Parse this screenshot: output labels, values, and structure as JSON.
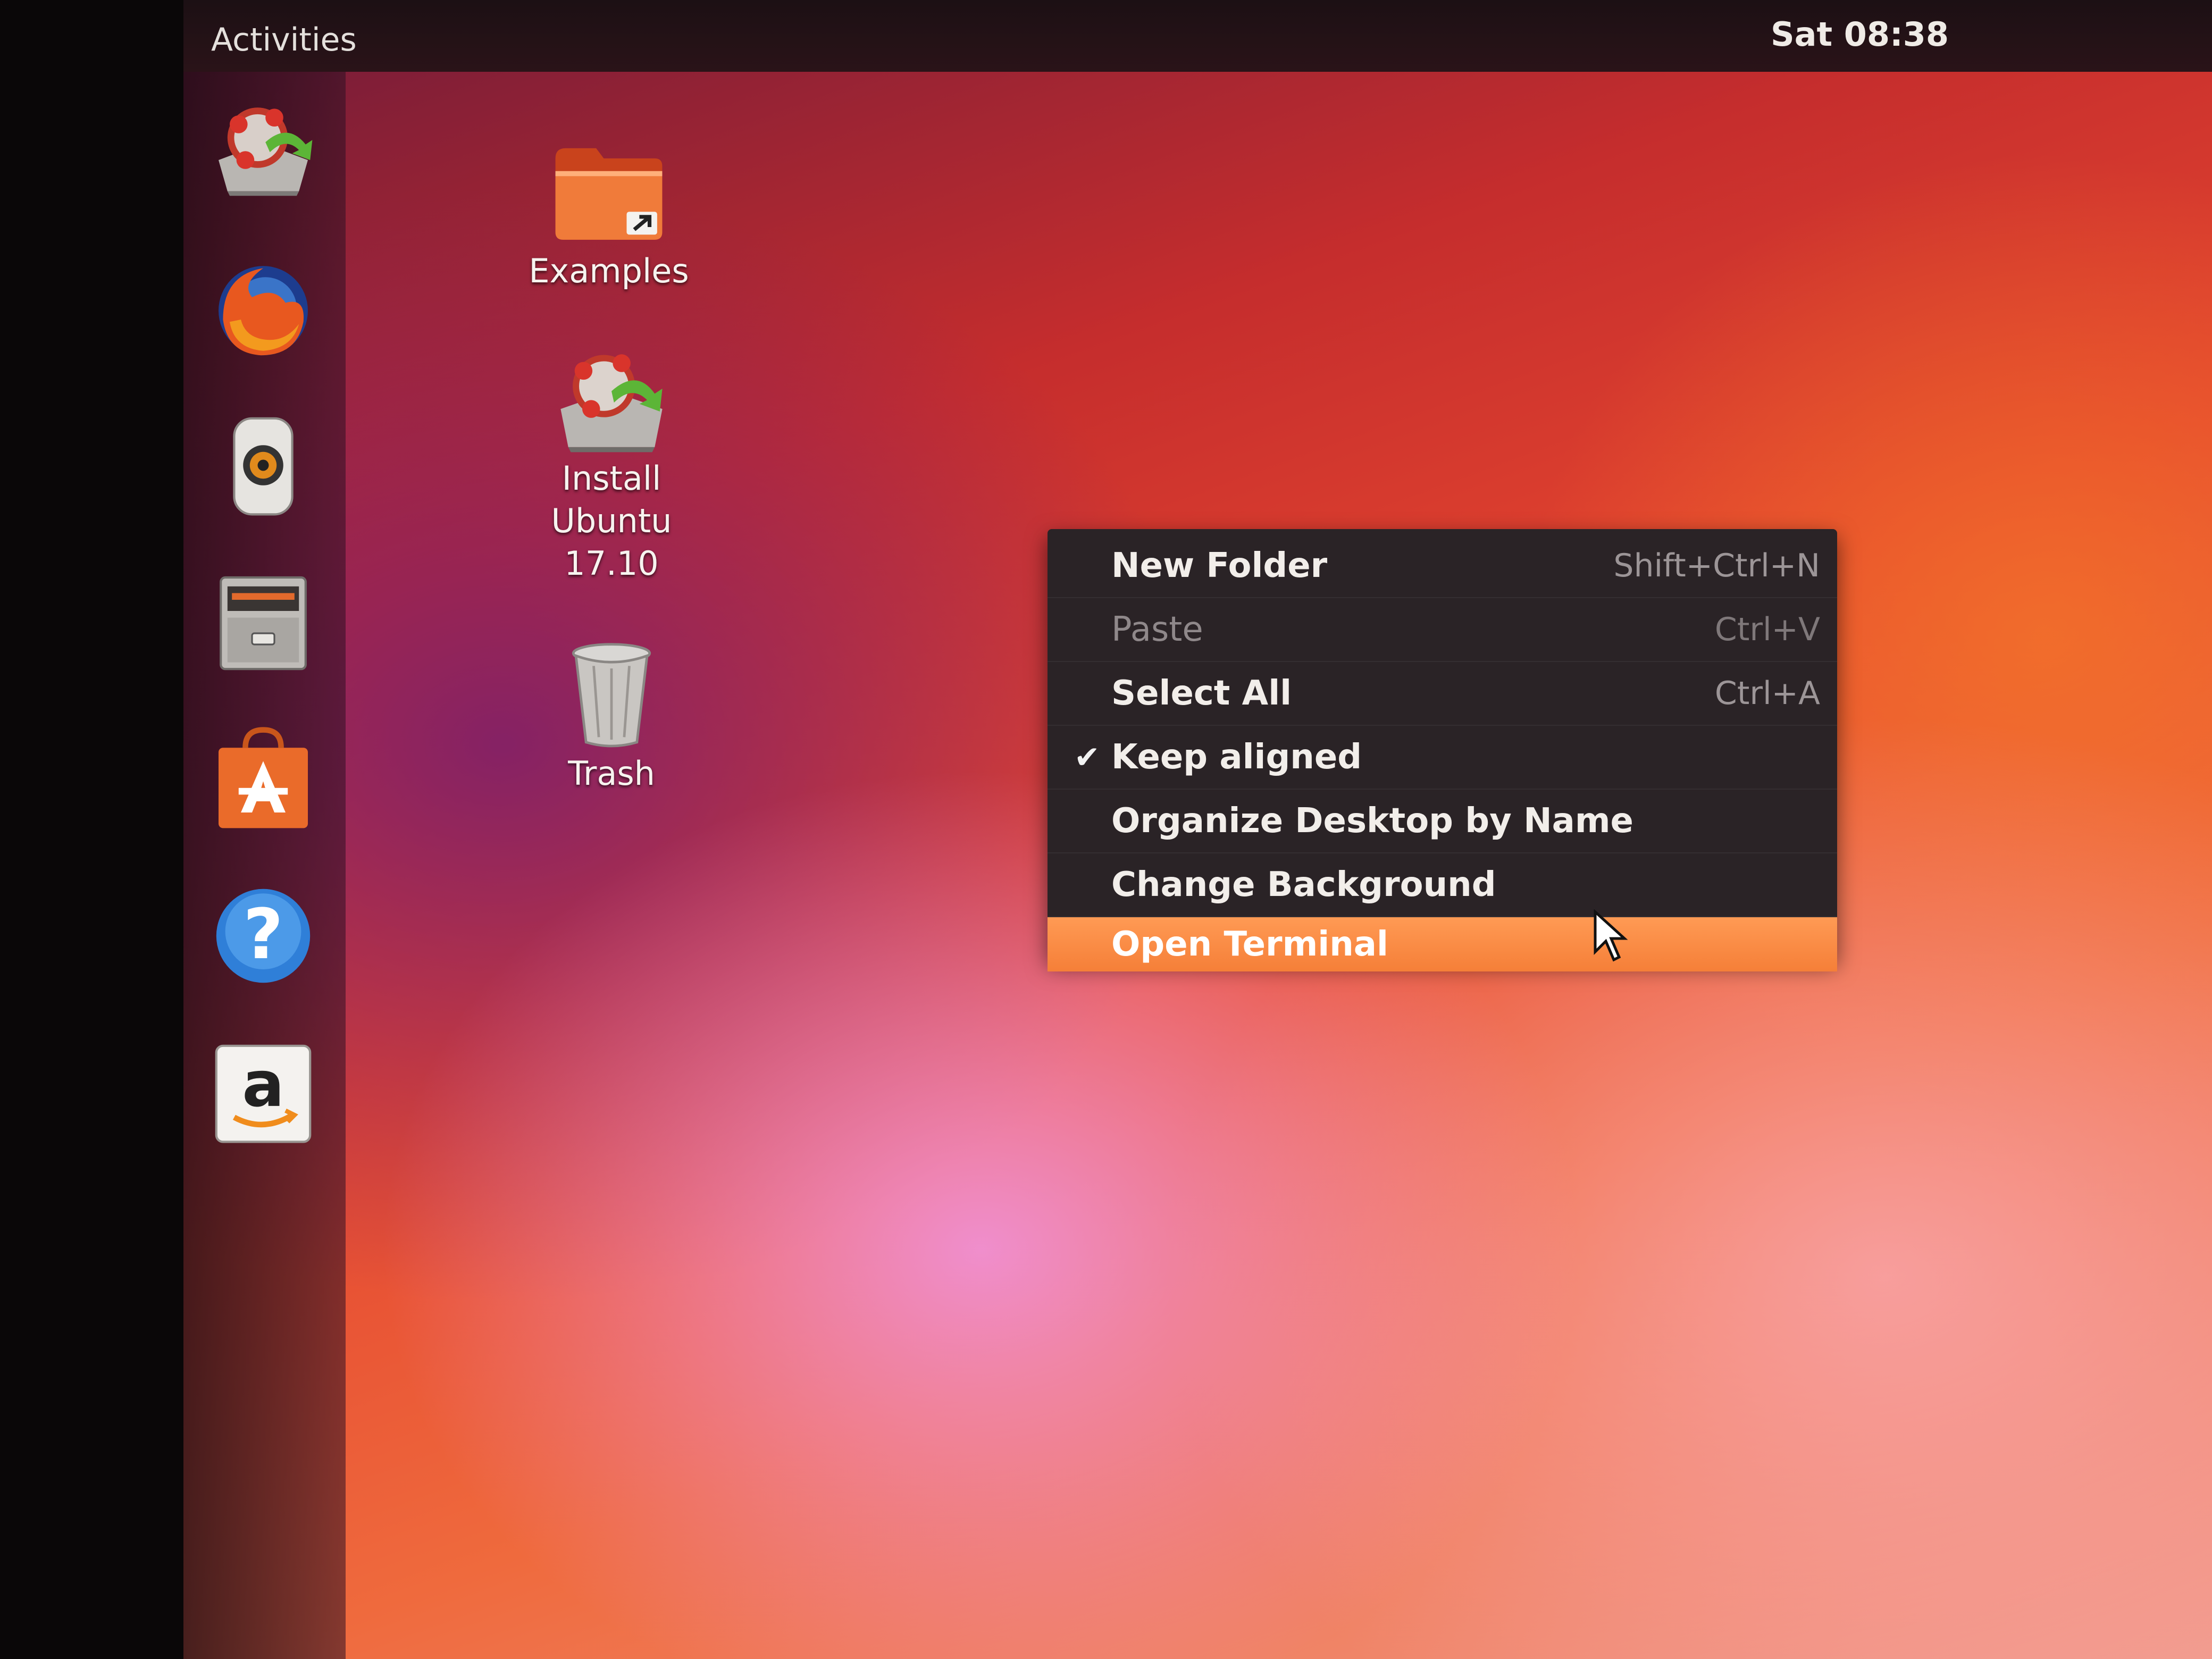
{
  "topbar": {
    "activities_label": "Activities",
    "clock": "Sat 08:38"
  },
  "dock": {
    "items": [
      {
        "icon": "install-ubuntu-icon"
      },
      {
        "icon": "firefox-icon"
      },
      {
        "icon": "rhythmbox-icon"
      },
      {
        "icon": "files-icon"
      },
      {
        "icon": "software-icon"
      },
      {
        "icon": "help-icon"
      },
      {
        "icon": "amazon-icon"
      }
    ]
  },
  "desktop": {
    "icons": [
      {
        "label": "Examples",
        "icon": "folder-link-icon"
      },
      {
        "label": "Install\nUbuntu\n17.10",
        "icon": "install-ubuntu-icon"
      },
      {
        "label": "Trash",
        "icon": "trash-icon"
      }
    ]
  },
  "context_menu": {
    "items": [
      {
        "label": "New Folder",
        "shortcut": "Shift+Ctrl+N"
      },
      {
        "label": "Paste",
        "shortcut": "Ctrl+V",
        "disabled": true
      },
      {
        "label": "Select All",
        "shortcut": "Ctrl+A"
      },
      {
        "label": "Keep aligned",
        "checked": true,
        "check_mark": "✔"
      },
      {
        "label": "Organize Desktop by Name"
      },
      {
        "label": "Change Background"
      },
      {
        "label": "Open Terminal",
        "highlighted": true
      }
    ]
  },
  "colors": {
    "menu_bg": "#2a2326",
    "menu_highlight": "#f68a45",
    "topbar_bg": "#1c1014"
  }
}
